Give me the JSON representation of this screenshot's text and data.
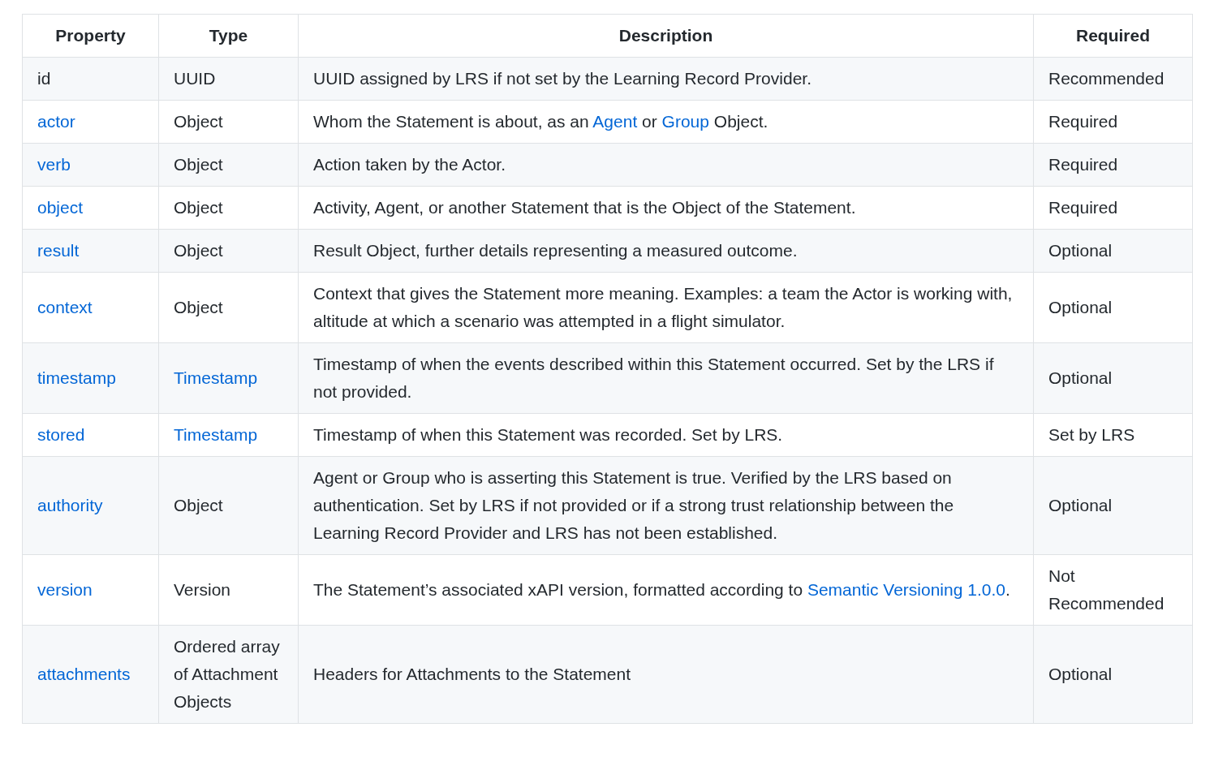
{
  "table": {
    "columns": [
      "Property",
      "Type",
      "Description",
      "Required"
    ],
    "rows": [
      {
        "property": [
          {
            "kind": "text",
            "text": "id"
          }
        ],
        "type": [
          {
            "kind": "text",
            "text": "UUID"
          }
        ],
        "description": [
          {
            "kind": "text",
            "text": "UUID assigned by LRS if not set by the Learning Record Provider."
          }
        ],
        "required": "Recommended"
      },
      {
        "property": [
          {
            "kind": "link",
            "text": "actor"
          }
        ],
        "type": [
          {
            "kind": "text",
            "text": "Object"
          }
        ],
        "description": [
          {
            "kind": "text",
            "text": "Whom the Statement is about, as an "
          },
          {
            "kind": "link",
            "text": "Agent"
          },
          {
            "kind": "text",
            "text": " or "
          },
          {
            "kind": "link",
            "text": "Group"
          },
          {
            "kind": "text",
            "text": " Object."
          }
        ],
        "required": "Required"
      },
      {
        "property": [
          {
            "kind": "link",
            "text": "verb"
          }
        ],
        "type": [
          {
            "kind": "text",
            "text": "Object"
          }
        ],
        "description": [
          {
            "kind": "text",
            "text": "Action taken by the Actor."
          }
        ],
        "required": "Required"
      },
      {
        "property": [
          {
            "kind": "link",
            "text": "object"
          }
        ],
        "type": [
          {
            "kind": "text",
            "text": "Object"
          }
        ],
        "description": [
          {
            "kind": "text",
            "text": "Activity, Agent, or another Statement that is the Object of the Statement."
          }
        ],
        "required": "Required"
      },
      {
        "property": [
          {
            "kind": "link",
            "text": "result"
          }
        ],
        "type": [
          {
            "kind": "text",
            "text": "Object"
          }
        ],
        "description": [
          {
            "kind": "text",
            "text": "Result Object, further details representing a measured outcome."
          }
        ],
        "required": "Optional"
      },
      {
        "property": [
          {
            "kind": "link",
            "text": "context"
          }
        ],
        "type": [
          {
            "kind": "text",
            "text": "Object"
          }
        ],
        "description": [
          {
            "kind": "text",
            "text": "Context that gives the Statement more meaning. Examples: a team the Actor is working with, altitude at which a scenario was attempted in a flight simulator."
          }
        ],
        "required": "Optional"
      },
      {
        "property": [
          {
            "kind": "link",
            "text": "timestamp"
          }
        ],
        "type": [
          {
            "kind": "link",
            "text": "Timestamp"
          }
        ],
        "description": [
          {
            "kind": "text",
            "text": "Timestamp of when the events described within this Statement occurred. Set by the LRS if not provided."
          }
        ],
        "required": "Optional"
      },
      {
        "property": [
          {
            "kind": "link",
            "text": "stored"
          }
        ],
        "type": [
          {
            "kind": "link",
            "text": "Timestamp"
          }
        ],
        "description": [
          {
            "kind": "text",
            "text": "Timestamp of when this Statement was recorded. Set by LRS."
          }
        ],
        "required": "Set by LRS"
      },
      {
        "property": [
          {
            "kind": "link",
            "text": "authority"
          }
        ],
        "type": [
          {
            "kind": "text",
            "text": "Object"
          }
        ],
        "description": [
          {
            "kind": "text",
            "text": "Agent or Group who is asserting this Statement is true. Verified by the LRS based on authentication. Set by LRS if not provided or if a strong trust relationship between the Learning Record Provider and LRS has not been established."
          }
        ],
        "required": "Optional"
      },
      {
        "property": [
          {
            "kind": "link",
            "text": "version"
          }
        ],
        "type": [
          {
            "kind": "text",
            "text": "Version"
          }
        ],
        "description": [
          {
            "kind": "text",
            "text": "The Statement’s associated xAPI version, formatted according to "
          },
          {
            "kind": "link",
            "text": "Semantic Versioning 1.0.0"
          },
          {
            "kind": "text",
            "text": "."
          }
        ],
        "required": "Not Recommended"
      },
      {
        "property": [
          {
            "kind": "link",
            "text": "attachments"
          }
        ],
        "type": [
          {
            "kind": "text",
            "text": "Ordered array of Attachment Objects"
          }
        ],
        "description": [
          {
            "kind": "text",
            "text": "Headers for Attachments to the Statement"
          }
        ],
        "required": "Optional"
      }
    ]
  }
}
